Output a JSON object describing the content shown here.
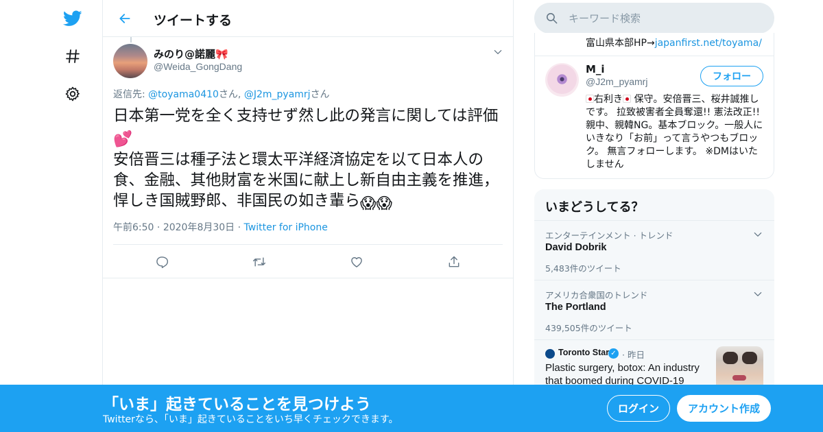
{
  "nav": {
    "items": [
      {
        "icon": "twitter-bird-icon"
      },
      {
        "icon": "hashtag-icon"
      },
      {
        "icon": "gear-icon"
      }
    ]
  },
  "header": {
    "title": "ツイートする"
  },
  "tweet": {
    "user_name": "みのり@諾麗",
    "user_name_emoji": "🎀",
    "user_handle": "@Weida_GongDang",
    "reply_prefix": "返信先: ",
    "reply_user_1": "@toyama0410",
    "reply_mid": "さん, ",
    "reply_user_2": "@J2m_pyamrj",
    "reply_suffix": "さん",
    "text_part1": "日本第一党を全く支持せず然し此の発言に関しては評価",
    "text_emoji1": "💕",
    "text_part2": "安倍晋三は種子法と環太平洋経済協定を以て日本人の食、金融、其他財富を米国に献上し新自由主義を推進，悍しき国賊野郎、非国民の如き輩ら",
    "text_emoji2": "😱😱",
    "time": "午前6:50",
    "dot": "·",
    "date": "2020年8月30日",
    "source": "Twitter for iPhone"
  },
  "search": {
    "placeholder": "キーワード検索"
  },
  "profile_card": {
    "prev_text": "富山県本部HP→",
    "prev_link": "japanfirst.net/toyama/",
    "name": "M_i",
    "handle": "@J2m_pyamrj",
    "follow_label": "フォロー",
    "bio_part1": "右利き",
    "bio_part2": "保守。安倍晋三、桜井誠推しです。 拉致被害者全員奪還!! 憲法改正!! 親中、親韓NG。基本ブロック。一般人にいきなり「お前」って言うやつもブロック。 無言フォローします。 ※DMはいたしません"
  },
  "trends": {
    "title": "いまどうしてる？",
    "items": [
      {
        "category": "エンターテインメント · トレンド",
        "name": "David Dobrik",
        "count": "5,483件のツイート"
      },
      {
        "category": "アメリカ合衆国のトレンド",
        "name": "The Portland",
        "count": "439,505件のツイート"
      }
    ],
    "news": {
      "source": "Toronto Star",
      "time": "· 昨日",
      "title": "Plastic surgery, botox: An industry that boomed during COVID-19"
    }
  },
  "banner": {
    "title": "「いま」起きていることを見つけよう",
    "subtitle": "Twitterなら、「いま」起きていることをいち早くチェックできます。",
    "login_label": "ログイン",
    "signup_label": "アカウント作成"
  },
  "colors": {
    "brand": "#1da1f2",
    "link": "#1b95e0",
    "muted": "#657786",
    "border": "#e6ecf0"
  }
}
